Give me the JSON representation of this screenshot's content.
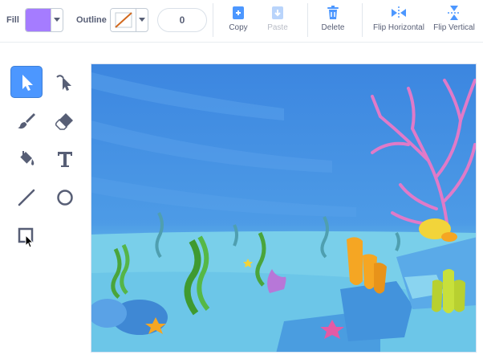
{
  "toolbar": {
    "fill_label": "Fill",
    "fill_color": "#a57cff",
    "outline_label": "Outline",
    "outline_size": "0",
    "copy_label": "Copy",
    "paste_label": "Paste",
    "delete_label": "Delete",
    "flip_h_label": "Flip Horizontal",
    "flip_v_label": "Flip Vertical"
  },
  "tools": [
    {
      "name": "select",
      "icon": "arrow-pointer-icon",
      "active": true
    },
    {
      "name": "reshape",
      "icon": "reshape-pointer-icon"
    },
    {
      "name": "brush",
      "icon": "brush-icon"
    },
    {
      "name": "eraser",
      "icon": "eraser-icon"
    },
    {
      "name": "fill",
      "icon": "paint-bucket-icon"
    },
    {
      "name": "text",
      "icon": "text-T-icon"
    },
    {
      "name": "line",
      "icon": "line-icon"
    },
    {
      "name": "circle",
      "icon": "circle-icon"
    },
    {
      "name": "rectangle",
      "icon": "rectangle-icon"
    }
  ],
  "colors": {
    "accent": "#4c97ff",
    "water_top": "#3b86e0",
    "water_bottom": "#7bd3ea",
    "coral_pink": "#e07ac8",
    "coral_orange": "#f5a623",
    "coral_yellow": "#c8e03b",
    "seaweed_green": "#4aa53b",
    "rock_blue": "#4a9de0"
  }
}
